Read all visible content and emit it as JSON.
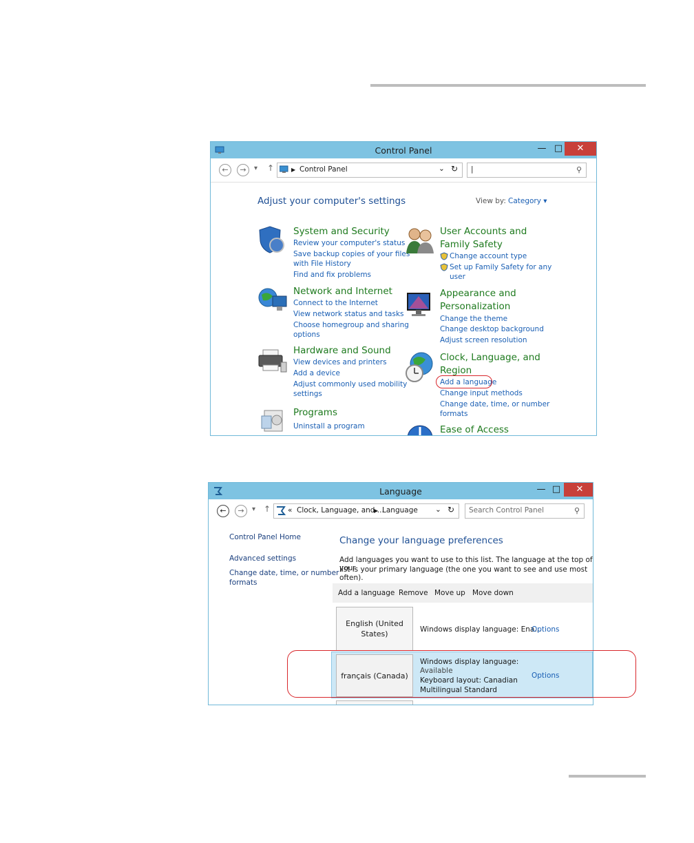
{
  "control_panel": {
    "title": "Control Panel",
    "address": "Control Panel",
    "heading": "Adjust your computer's settings",
    "view_by_label": "View by:",
    "view_by_value": "Category ▾",
    "categories": [
      {
        "title": "System and Security",
        "icon": "shield-icon",
        "links": [
          "Review your computer's status",
          "Save backup copies of your files",
          "with File History",
          "Find and fix problems"
        ]
      },
      {
        "title": "Network and Internet",
        "icon": "network-globe-icon",
        "links": [
          "Connect to the Internet",
          "View network status and tasks",
          "Choose homegroup and sharing",
          "options"
        ]
      },
      {
        "title": "Hardware and Sound",
        "icon": "printer-icon",
        "links": [
          "View devices and printers",
          "Add a device",
          "Adjust commonly used mobility",
          "settings"
        ]
      },
      {
        "title": "Programs",
        "icon": "programs-icon",
        "links": [
          "Uninstall a program"
        ]
      },
      {
        "title_lines": [
          "User Accounts and",
          "Family Safety"
        ],
        "icon": "users-icon",
        "links": [
          "Change account type",
          "Set up Family Safety for any",
          "user"
        ]
      },
      {
        "title_lines": [
          "Appearance and",
          "Personalization"
        ],
        "icon": "display-icon",
        "links": [
          "Change the theme",
          "Change desktop background",
          "Adjust screen resolution"
        ]
      },
      {
        "title_lines": [
          "Clock, Language, and",
          "Region"
        ],
        "icon": "clock-globe-icon",
        "links": [
          "Add a language",
          "Change input methods",
          "Change date, time, or number",
          "formats"
        ]
      },
      {
        "title": "Ease of Access",
        "icon": "ease-of-access-icon",
        "links": []
      }
    ]
  },
  "language": {
    "title": "Language",
    "breadcrumb_prefix": "«",
    "breadcrumb_parent": "Clock, Language, and ...",
    "breadcrumb_current": "Language",
    "search_placeholder": "Search Control Panel",
    "sidebar": [
      "Control Panel Home",
      "Advanced settings",
      "Change date, time, or number",
      "formats"
    ],
    "heading": "Change your language preferences",
    "description_lines": [
      "Add languages you want to use to this list. The language at the top of your",
      "list is your primary language (the one you want to see and use most often)."
    ],
    "toolbar": [
      "Add a language",
      "Remove",
      "Move up",
      "Move down"
    ],
    "rows": [
      {
        "name_lines": [
          "English (United",
          "States)"
        ],
        "info_lines": [
          "Windows display language: Ena..."
        ],
        "options": "Options"
      },
      {
        "name_lines": [
          "français (Canada)"
        ],
        "info_lines": [
          "Windows display language:",
          "Available",
          "Keyboard layout: Canadian",
          "Multilingual Standard"
        ],
        "options": "Options"
      }
    ]
  },
  "colors": {
    "accent": "#7ec3e2",
    "link": "#1a5fb4",
    "category": "#1e7a1e",
    "highlight": "#d8252a",
    "selected_row": "#cde8f6"
  }
}
